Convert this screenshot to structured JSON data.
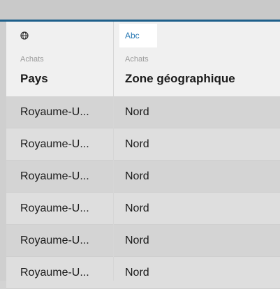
{
  "columns": [
    {
      "type_icon": "globe-icon",
      "source": "Achats",
      "name": "Pays"
    },
    {
      "type_icon": "Abc",
      "source": "Achats",
      "name": "Zone géographique"
    }
  ],
  "rows": [
    {
      "pays": "Royaume-U...",
      "zone": "Nord"
    },
    {
      "pays": "Royaume-U...",
      "zone": "Nord"
    },
    {
      "pays": "Royaume-U...",
      "zone": "Nord"
    },
    {
      "pays": "Royaume-U...",
      "zone": "Nord"
    },
    {
      "pays": "Royaume-U...",
      "zone": "Nord"
    },
    {
      "pays": "Royaume-U...",
      "zone": "Nord"
    }
  ],
  "colors": {
    "accent": "#1d5f8a",
    "type_label": "#2a7ab5"
  }
}
